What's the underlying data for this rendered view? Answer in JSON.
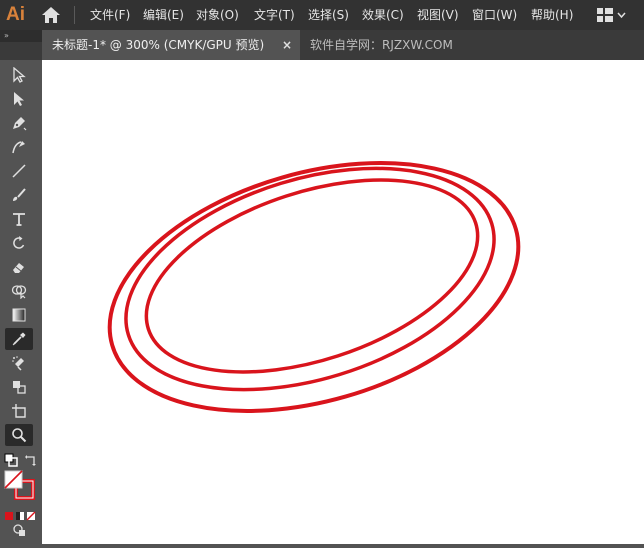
{
  "app": {
    "logo": "Ai"
  },
  "menu": [
    "文件(F)",
    "编辑(E)",
    "对象(O)",
    "文字(T)",
    "选择(S)",
    "效果(C)",
    "视图(V)",
    "窗口(W)",
    "帮助(H)"
  ],
  "tabs": {
    "active": "未标题-1* @ 300% (CMYK/GPU 预览)",
    "close": "×",
    "other": "软件自学网：RJZXW.COM"
  },
  "colors": {
    "stroke": "#d9141c",
    "canvas": "#ffffff",
    "ui_dark": "#323232",
    "ui_mid": "#535353",
    "logo": "#d9823b"
  },
  "tools": [
    "selection-tool",
    "direct-selection-tool",
    "pen-tool",
    "curvature-tool",
    "line-segment-tool",
    "paintbrush-tool",
    "type-tool",
    "rotate-tool",
    "eraser-tool",
    "shape-builder-tool",
    "gradient-tool",
    "eyedropper-tool",
    "symbol-sprayer-tool",
    "live-paint-tool",
    "artboard-tool",
    "zoom-tool"
  ]
}
